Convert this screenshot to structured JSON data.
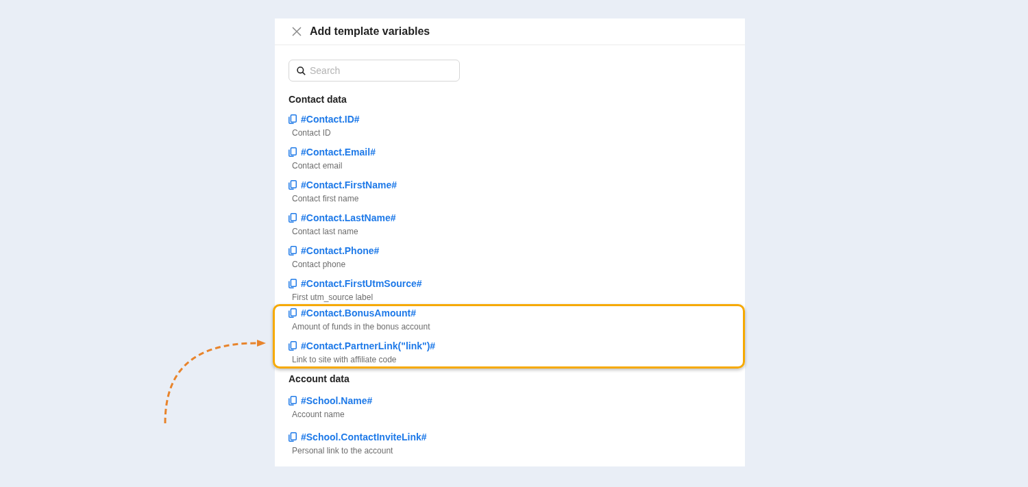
{
  "dialog": {
    "title": "Add template variables"
  },
  "search": {
    "placeholder": "Search"
  },
  "sections": [
    {
      "title": "Contact data",
      "items": [
        {
          "variable": "#Contact.ID#",
          "description": "Contact ID",
          "highlighted": false
        },
        {
          "variable": "#Contact.Email#",
          "description": "Contact email",
          "highlighted": false
        },
        {
          "variable": "#Contact.FirstName#",
          "description": "Contact first name",
          "highlighted": false
        },
        {
          "variable": "#Contact.LastName#",
          "description": "Contact last name",
          "highlighted": false
        },
        {
          "variable": "#Contact.Phone#",
          "description": "Contact phone",
          "highlighted": false
        },
        {
          "variable": "#Contact.FirstUtmSource#",
          "description": "First utm_source label",
          "highlighted": false
        },
        {
          "variable": "#Contact.BonusAmount#",
          "description": "Amount of funds in the bonus account",
          "highlighted": true
        },
        {
          "variable": "#Contact.PartnerLink(\"link\")#",
          "description": "Link to site with affiliate code",
          "highlighted": true
        }
      ]
    },
    {
      "title": "Account data",
      "items": [
        {
          "variable": "#School.Name#",
          "description": "Account name",
          "highlighted": false
        },
        {
          "variable": "#School.ContactInviteLink#",
          "description": "Personal link to the account",
          "highlighted": false
        }
      ]
    }
  ]
}
